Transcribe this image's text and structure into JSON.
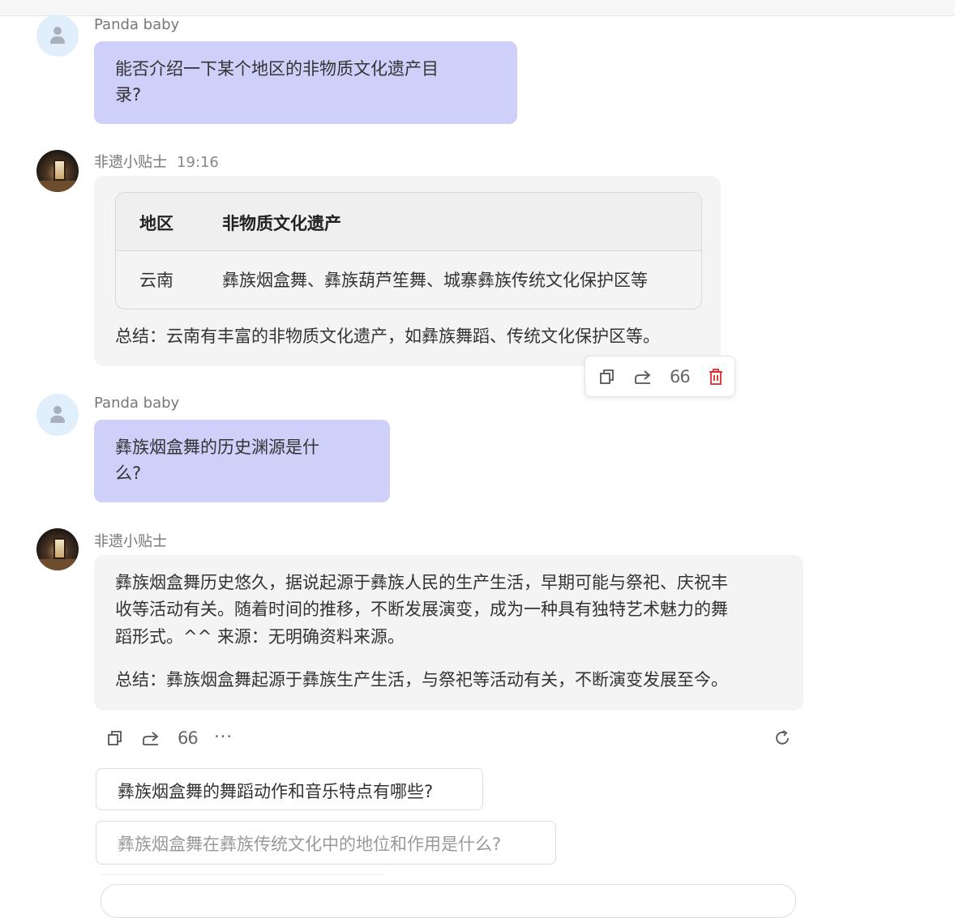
{
  "messages": [
    {
      "role": "user",
      "sender": "Panda baby",
      "text": "能否介绍一下某个地区的非物质文化遗产目\n录?"
    },
    {
      "role": "bot",
      "sender": "非遗小贴士",
      "time": "19:16",
      "table": {
        "headers": [
          "地区",
          "非物质文化遗产"
        ],
        "rows": [
          [
            "云南",
            "彝族烟盒舞、彝族葫芦笙舞、城寨彝族传统文化保护区等"
          ]
        ]
      },
      "summary": "总结：云南有丰富的非物质文化遗产，如彝族舞蹈、传统文化保护区等。"
    },
    {
      "role": "user",
      "sender": "Panda baby",
      "text": "彝族烟盒舞的历史渊源是什\n么?"
    },
    {
      "role": "bot",
      "sender": "非遗小贴士",
      "paragraphs": [
        "彝族烟盒舞历史悠久，据说起源于彝族人民的生产生活，早期可能与祭祀、庆祝丰",
        "收等活动有关。随着时间的推移，不断发展演变，成为一种具有独特艺术魅力的舞",
        "蹈形式。^^ 来源：无明确资料来源。"
      ],
      "summary": "总结：彝族烟盒舞起源于彝族生产生活，与祭祀等活动有关，不断演变发展至今。"
    }
  ],
  "actions": {
    "copy_icon": "copy-icon",
    "share_icon": "share-icon",
    "quote_icon": "quote-icon",
    "quote_text": "66",
    "delete_icon": "trash-icon",
    "more_text": "···",
    "refresh_icon": "refresh-icon"
  },
  "suggestions": [
    "彝族烟盒舞的舞蹈动作和音乐特点有哪些?",
    "彝族烟盒舞在彝族传统文化中的地位和作用是什么?"
  ],
  "colors": {
    "user_bubble": "#cfd0fa",
    "bot_bubble": "#f4f4f4",
    "delete_red": "#e0282e"
  }
}
